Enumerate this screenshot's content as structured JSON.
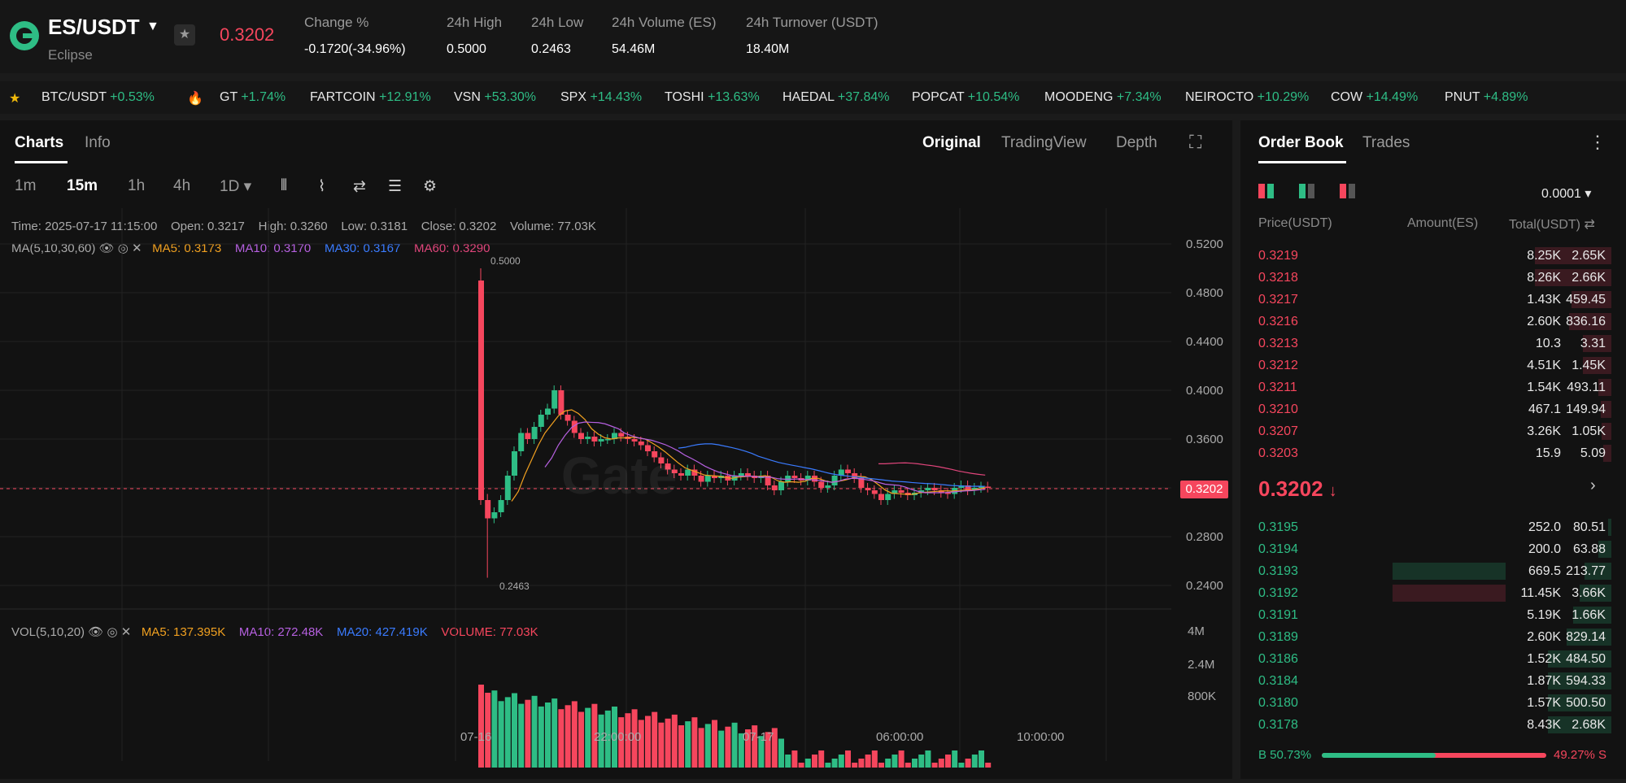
{
  "header": {
    "pair": "ES/USDT",
    "pair_sub": "Eclipse",
    "last_price": "0.3202",
    "stats": [
      {
        "label": "Change %",
        "value": "-0.1720(-34.96%)",
        "color": "#f6465d"
      },
      {
        "label": "24h High",
        "value": "0.5000"
      },
      {
        "label": "24h Low",
        "value": "0.2463"
      },
      {
        "label": "24h Volume (ES)",
        "value": "54.46M"
      },
      {
        "label": "24h Turnover (USDT)",
        "value": "18.40M"
      }
    ]
  },
  "ticker": [
    {
      "name": "BTC/USDT",
      "change": "+0.53%",
      "icon": "star-icon"
    },
    {
      "name": "GT",
      "change": "+1.74%",
      "icon": "fire-icon"
    },
    {
      "name": "FARTCOIN",
      "change": "+12.91%"
    },
    {
      "name": "VSN",
      "change": "+53.30%"
    },
    {
      "name": "SPX",
      "change": "+14.43%"
    },
    {
      "name": "TOSHI",
      "change": "+13.63%"
    },
    {
      "name": "HAEDAL",
      "change": "+37.84%"
    },
    {
      "name": "POPCAT",
      "change": "+10.54%"
    },
    {
      "name": "MOODENG",
      "change": "+7.34%"
    },
    {
      "name": "NEIROCTO",
      "change": "+10.29%"
    },
    {
      "name": "COW",
      "change": "+14.49%"
    },
    {
      "name": "PNUT",
      "change": "+4.89%"
    }
  ],
  "chart": {
    "tabs": [
      "Charts",
      "Info"
    ],
    "views": [
      "Original",
      "TradingView",
      "Depth"
    ],
    "timeframes": [
      "1m",
      "15m",
      "1h",
      "4h",
      "1D"
    ],
    "active_timeframe": "15m",
    "info": {
      "time": "Time: 2025-07-17 11:15:00",
      "open": "Open: 0.3217",
      "high": "High: 0.3260",
      "low": "Low: 0.3181",
      "close": "Close: 0.3202",
      "volume": "Volume: 77.03K"
    },
    "ma": {
      "label": "MA(5,10,30,60)",
      "ma5": "MA5: 0.3173",
      "ma10": "MA10: 0.3170",
      "ma30": "MA30: 0.3167",
      "ma60": "MA60: 0.3290"
    },
    "vol": {
      "label": "VOL(5,10,20)",
      "ma5": "MA5: 137.395K",
      "ma10": "MA10: 272.48K",
      "ma20": "MA20: 427.419K",
      "volume": "VOLUME: 77.03K"
    },
    "price_axis": [
      "0.5200",
      "0.4800",
      "0.4400",
      "0.4000",
      "0.3600",
      "0.2800",
      "0.2400"
    ],
    "vol_axis": [
      "4M",
      "2.4M",
      "800K"
    ],
    "time_axis": [
      "07-16",
      "22:00:00",
      "07-17",
      "06:00:00",
      "10:00:00"
    ],
    "high_marker": "0.5000",
    "low_marker": "0.2463",
    "current_price_tag": "0.3202",
    "watermark": "Gate",
    "colors": {
      "up": "#2ebd85",
      "down": "#f6465d",
      "ma5": "#f0a020",
      "ma10": "#b660e0",
      "ma30": "#3a7bff",
      "ma60": "#e0457b"
    }
  },
  "orderbook": {
    "tabs": [
      "Order Book",
      "Trades"
    ],
    "precision": "0.0001",
    "headers": {
      "price": "Price(USDT)",
      "amount": "Amount(ES)",
      "total": "Total(USDT)"
    },
    "asks": [
      {
        "price": "0.3219",
        "amount": "8.25K",
        "total": "2.65K",
        "depth": 0.72
      },
      {
        "price": "0.3218",
        "amount": "8.26K",
        "total": "2.66K",
        "depth": 0.72
      },
      {
        "price": "0.3217",
        "amount": "1.43K",
        "total": "459.45",
        "depth": 0.38
      },
      {
        "price": "0.3216",
        "amount": "2.60K",
        "total": "836.16",
        "depth": 0.4
      },
      {
        "price": "0.3213",
        "amount": "10.3",
        "total": "3.31",
        "depth": 0.27
      },
      {
        "price": "0.3212",
        "amount": "4.51K",
        "total": "1.45K",
        "depth": 0.27
      },
      {
        "price": "0.3211",
        "amount": "1.54K",
        "total": "493.11",
        "depth": 0.12
      },
      {
        "price": "0.3210",
        "amount": "467.1",
        "total": "149.94",
        "depth": 0.1
      },
      {
        "price": "0.3207",
        "amount": "3.26K",
        "total": "1.05K",
        "depth": 0.09
      },
      {
        "price": "0.3203",
        "amount": "15.9",
        "total": "5.09",
        "depth": 0.08
      }
    ],
    "mid_price": "0.3202",
    "bids": [
      {
        "price": "0.3195",
        "amount": "252.0",
        "total": "80.51",
        "depth": 0.03,
        "amtdepth": 0
      },
      {
        "price": "0.3194",
        "amount": "200.0",
        "total": "63.88",
        "depth": 0.12,
        "amtdepth": 0
      },
      {
        "price": "0.3193",
        "amount": "669.5",
        "total": "213.77",
        "depth": 0.25,
        "amtdepth": 0.42
      },
      {
        "price": "0.3192",
        "amount": "11.45K",
        "total": "3.66K",
        "depth": 0.3,
        "amtdepth": 0.42
      },
      {
        "price": "0.3191",
        "amount": "5.19K",
        "total": "1.66K",
        "depth": 0.36,
        "amtdepth": 0
      },
      {
        "price": "0.3189",
        "amount": "2.60K",
        "total": "829.14",
        "depth": 0.42,
        "amtdepth": 0
      },
      {
        "price": "0.3186",
        "amount": "1.52K",
        "total": "484.50",
        "depth": 0.6,
        "amtdepth": 0
      },
      {
        "price": "0.3184",
        "amount": "1.87K",
        "total": "594.33",
        "depth": 0.6,
        "amtdepth": 0
      },
      {
        "price": "0.3180",
        "amount": "1.57K",
        "total": "500.50",
        "depth": 0.6,
        "amtdepth": 0
      },
      {
        "price": "0.3178",
        "amount": "8.43K",
        "total": "2.68K",
        "depth": 0.6,
        "amtdepth": 0
      }
    ],
    "buy_ratio": "B 50.73%",
    "sell_ratio": "49.27% S",
    "buy_fraction": 0.5073
  }
}
